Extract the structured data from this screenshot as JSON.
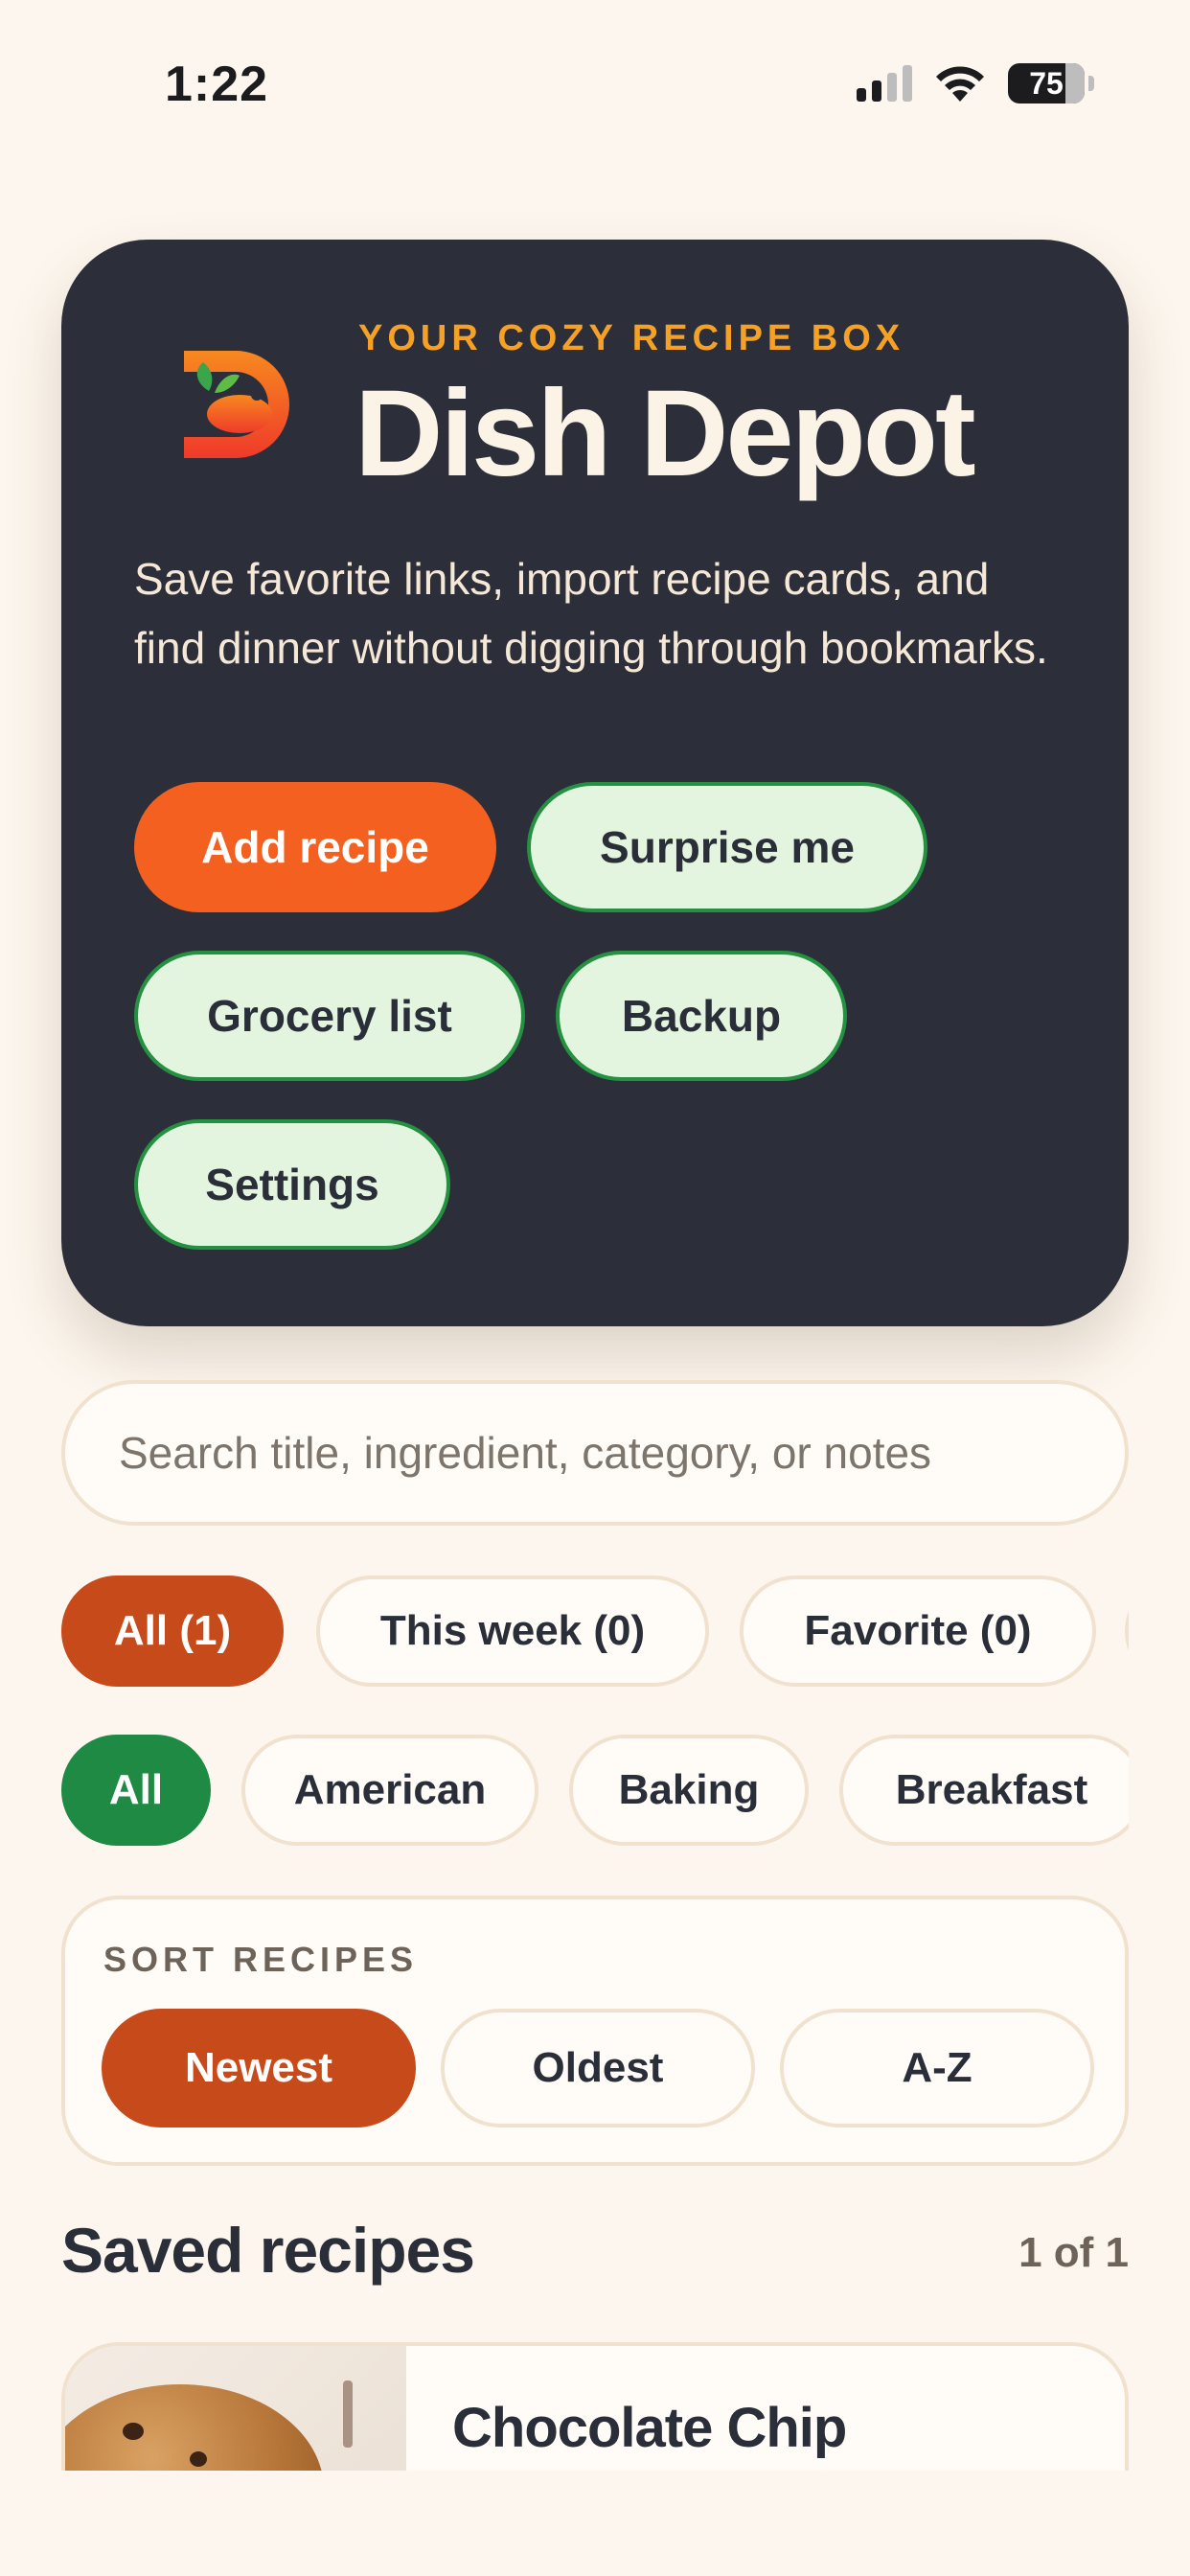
{
  "status_bar": {
    "time": "1:22",
    "battery": "75"
  },
  "hero": {
    "eyebrow": "YOUR COZY RECIPE BOX",
    "title": "Dish Depot",
    "subtitle": "Save favorite links, import recipe cards, and find dinner without digging through bookmarks.",
    "buttons": {
      "add_recipe": "Add recipe",
      "surprise_me": "Surprise me",
      "grocery_list": "Grocery list",
      "backup": "Backup",
      "settings": "Settings"
    }
  },
  "search": {
    "placeholder": "Search title, ingredient, category, or notes",
    "value": ""
  },
  "time_filters": [
    {
      "label": "All (1)",
      "active": true
    },
    {
      "label": "This week (0)",
      "active": false
    },
    {
      "label": "Favorite (0)",
      "active": false
    }
  ],
  "category_filters": [
    {
      "label": "All",
      "active": true
    },
    {
      "label": "American",
      "active": false
    },
    {
      "label": "Baking",
      "active": false
    },
    {
      "label": "Breakfast",
      "active": false
    }
  ],
  "sort": {
    "label": "SORT RECIPES",
    "options": [
      "Newest",
      "Oldest",
      "A-Z"
    ],
    "selected": "Newest"
  },
  "saved": {
    "title": "Saved recipes",
    "count": "1 of 1",
    "recipes": [
      {
        "title": "Chocolate Chip"
      }
    ]
  },
  "colors": {
    "background": "#fdf6ee",
    "hero": "#2c2f3a",
    "accent_orange": "#f4601f",
    "accent_red": "#c64a1a",
    "accent_green": "#1e8a43",
    "eyebrow": "#f5a125"
  }
}
